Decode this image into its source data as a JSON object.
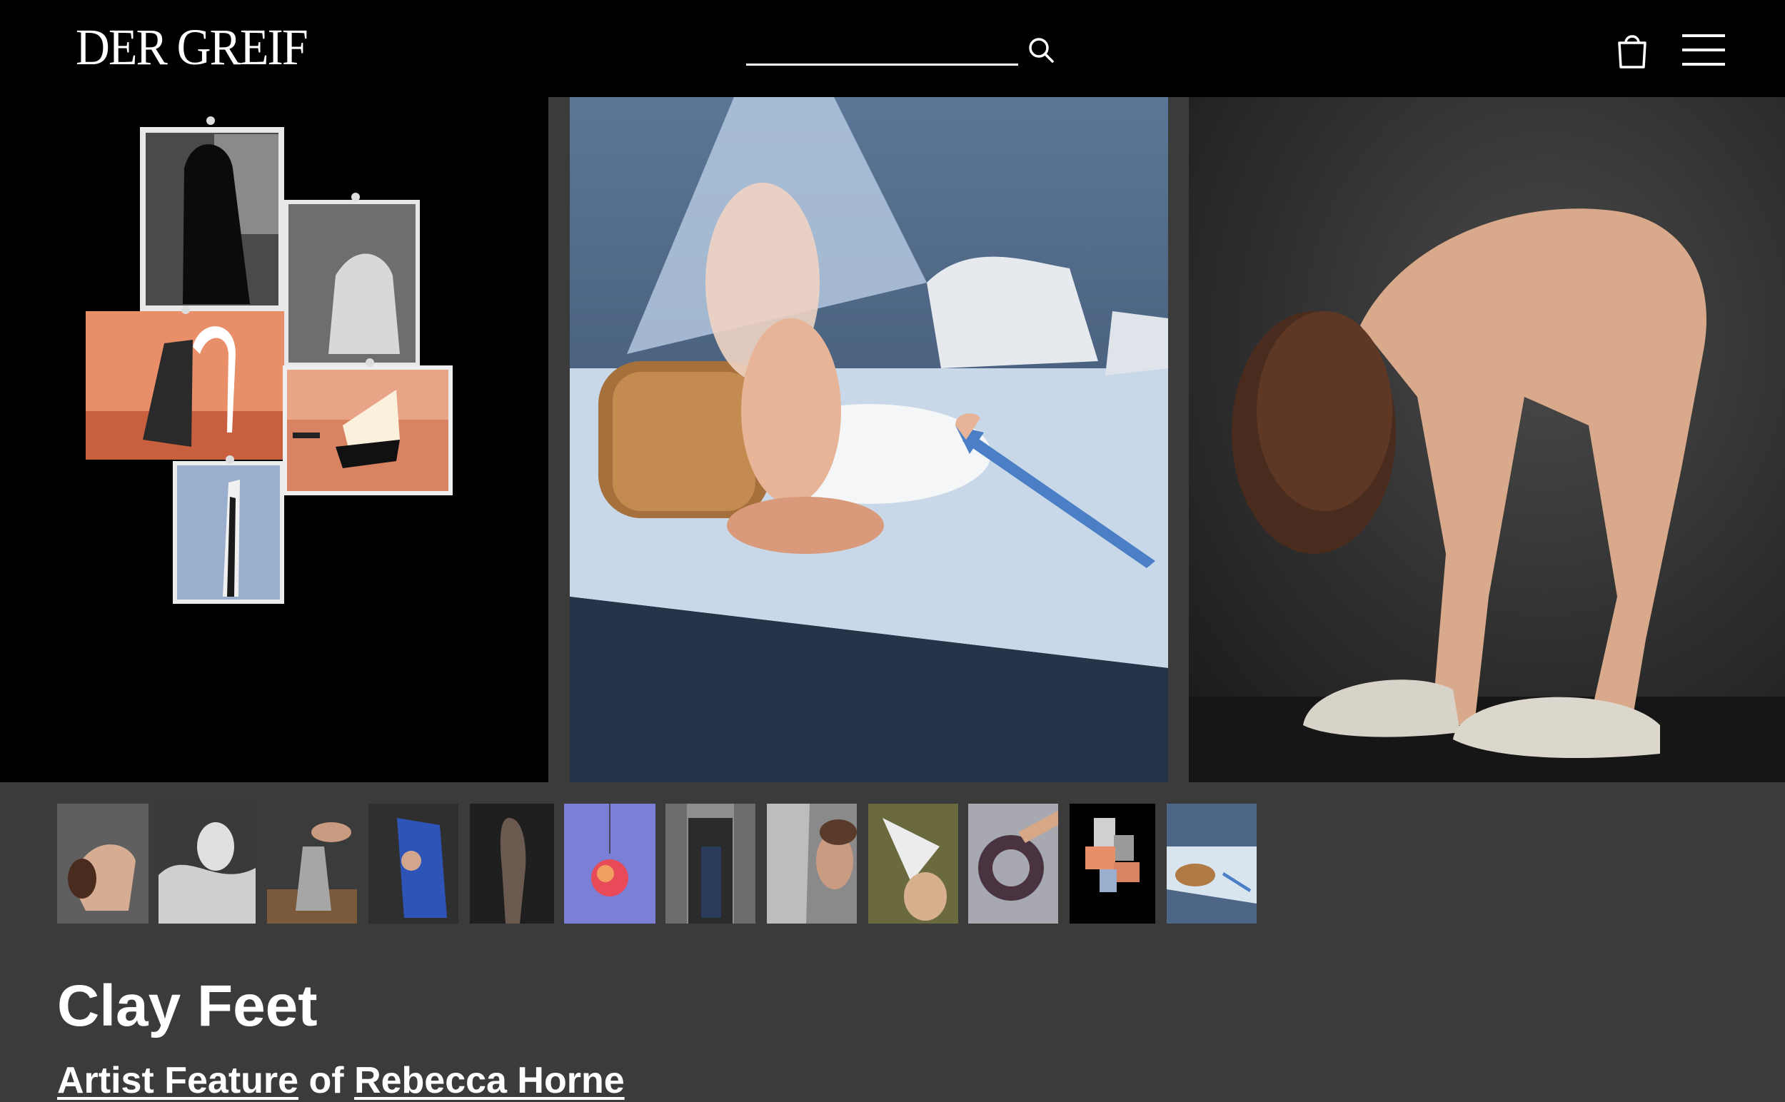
{
  "header": {
    "logo": "DER GREIF",
    "search_placeholder": ""
  },
  "gallery": {
    "images": [
      {
        "name": "collage-on-black"
      },
      {
        "name": "bread-and-plate-still-life"
      },
      {
        "name": "figure-bending-with-clay-feet"
      }
    ]
  },
  "thumbnails": [
    {
      "name": "thumb-1"
    },
    {
      "name": "thumb-2"
    },
    {
      "name": "thumb-3"
    },
    {
      "name": "thumb-4"
    },
    {
      "name": "thumb-5"
    },
    {
      "name": "thumb-6"
    },
    {
      "name": "thumb-7"
    },
    {
      "name": "thumb-8"
    },
    {
      "name": "thumb-9"
    },
    {
      "name": "thumb-10"
    },
    {
      "name": "thumb-11"
    },
    {
      "name": "thumb-12"
    }
  ],
  "article": {
    "title": "Clay Feet",
    "feature_link": "Artist Feature",
    "of_text": " of ",
    "artist_link": "Rebecca Horne"
  }
}
